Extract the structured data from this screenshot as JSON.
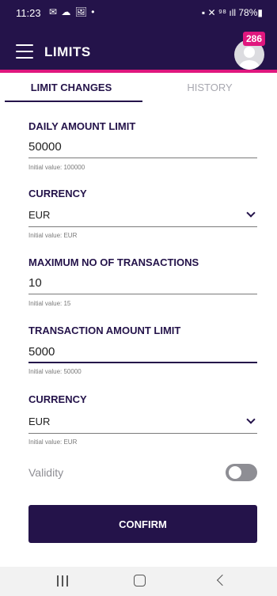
{
  "status_bar": {
    "time": "11:23",
    "left_icons": "✉ ☁ 🖼 •",
    "right_icons": "▪ ✕ ⁹⁸ ıll 78%▮"
  },
  "app_bar": {
    "title": "LIMITS",
    "badge_count": "286",
    "menu_icon": "hamburger-menu-icon",
    "avatar_icon": "user-avatar-icon"
  },
  "tabs": [
    {
      "label": "LIMIT CHANGES",
      "active": true
    },
    {
      "label": "HISTORY",
      "active": false
    }
  ],
  "form": {
    "daily_amount_limit": {
      "label": "DAILY AMOUNT LIMIT",
      "value": "50000",
      "hint": "Initial value: 100000"
    },
    "currency_1": {
      "label": "CURRENCY",
      "value": "EUR",
      "hint": "Initial value: EUR"
    },
    "max_transactions": {
      "label": "MAXIMUM NO OF TRANSACTIONS",
      "value": "10",
      "hint": "Initial value: 15"
    },
    "transaction_amount_limit": {
      "label": "TRANSACTION AMOUNT LIMIT",
      "value": "5000",
      "hint": "Initial value: 50000"
    },
    "currency_2": {
      "label": "CURRENCY",
      "value": "EUR",
      "hint": "Initial value: EUR"
    },
    "validity": {
      "label": "Validity",
      "enabled": false
    }
  },
  "confirm_button": {
    "label": "CONFIRM"
  },
  "colors": {
    "primary": "#24134a",
    "accent": "#e0177e",
    "toggle_off": "#8e8e94"
  },
  "nav_bar": {
    "recent_icon": "recent-apps-icon",
    "home_icon": "home-icon",
    "back_icon": "back-icon"
  }
}
